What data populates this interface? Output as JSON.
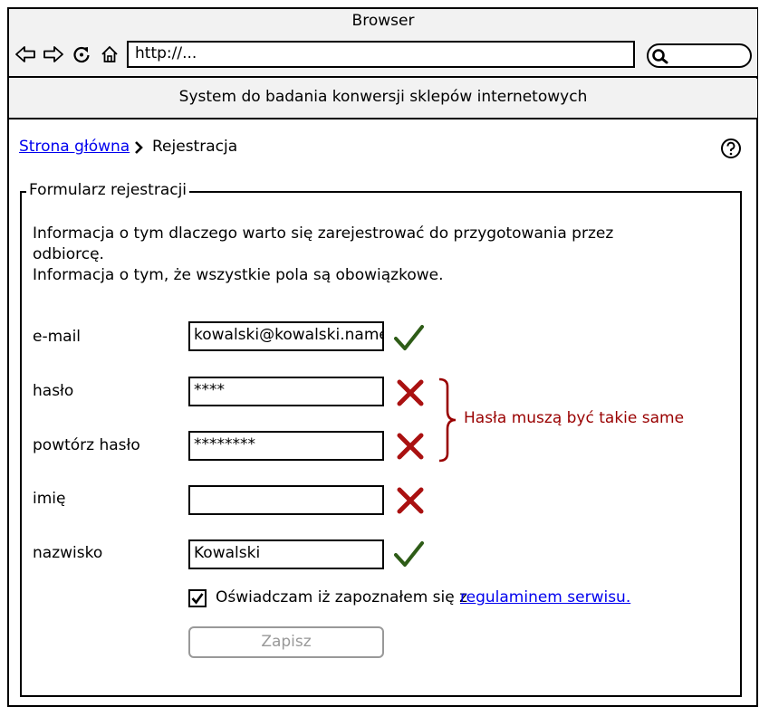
{
  "browser": {
    "title": "Browser",
    "url": "http://...",
    "nav_icons": [
      "back-arrow-icon",
      "forward-arrow-icon",
      "reload-icon",
      "home-icon"
    ]
  },
  "app": {
    "title": "System do badania konwersji sklepów internetowych"
  },
  "breadcrumb": {
    "home": "Strona główna",
    "current": "Rejestracja"
  },
  "form": {
    "legend": "Formularz rejestracji",
    "info_line1": "Informacja o tym dlaczego warto się zarejestrować do przygotowania przez odbiorcę.",
    "info_line2": "Informacja o tym, że wszystkie pola są obowiązkowe.",
    "fields": {
      "email": {
        "label": "e-mail",
        "value": "kowalski@kowalski.name",
        "status": "valid"
      },
      "password": {
        "label": "hasło",
        "value": "****",
        "status": "invalid"
      },
      "password_repeat": {
        "label": "powtórz hasło",
        "value": "********",
        "status": "invalid"
      },
      "first_name": {
        "label": "imię",
        "value": "",
        "status": "invalid"
      },
      "last_name": {
        "label": "nazwisko",
        "value": "Kowalski",
        "status": "valid"
      }
    },
    "password_error": "Hasła muszą być takie same",
    "consent": {
      "checked": true,
      "text": "Oświadczam iż zapoznałem się z",
      "link": "regulaminem serwisu."
    },
    "save_label": "Zapisz"
  },
  "colors": {
    "valid": "#2e5c17",
    "invalid": "#aa1111",
    "error_text": "#990000",
    "link": "#0000ee",
    "chrome_bg": "#f2f2f2"
  }
}
